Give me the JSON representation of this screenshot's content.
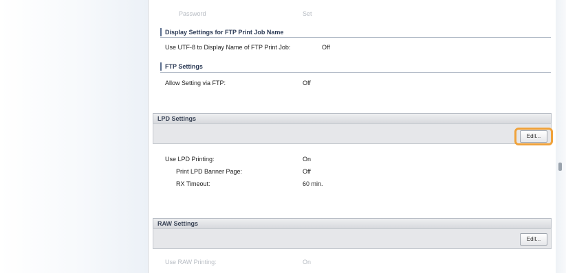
{
  "ftp": {
    "password_label": "Password",
    "password_value": "Set",
    "display_settings_title": "Display Settings for FTP Print Job Name",
    "utf8_label": "Use UTF-8 to Display Name of FTP Print Job:",
    "utf8_value": "Off",
    "ftp_settings_title": "FTP Settings",
    "allow_setting_label": "Allow Setting via FTP:",
    "allow_setting_value": "Off"
  },
  "lpd": {
    "header": "LPD Settings",
    "edit_label": "Edit...",
    "rows": [
      {
        "label": "Use LPD Printing:",
        "value": "On"
      },
      {
        "label": "Print LPD Banner Page:",
        "value": "Off"
      },
      {
        "label": "RX Timeout:",
        "value": "60 min."
      }
    ]
  },
  "raw": {
    "header": "RAW Settings",
    "edit_label": "Edit...",
    "row_label": "Use RAW Printing:",
    "row_value": "On"
  },
  "colors": {
    "highlight": "#f0a23a",
    "section_accent": "#5c6f8f"
  }
}
